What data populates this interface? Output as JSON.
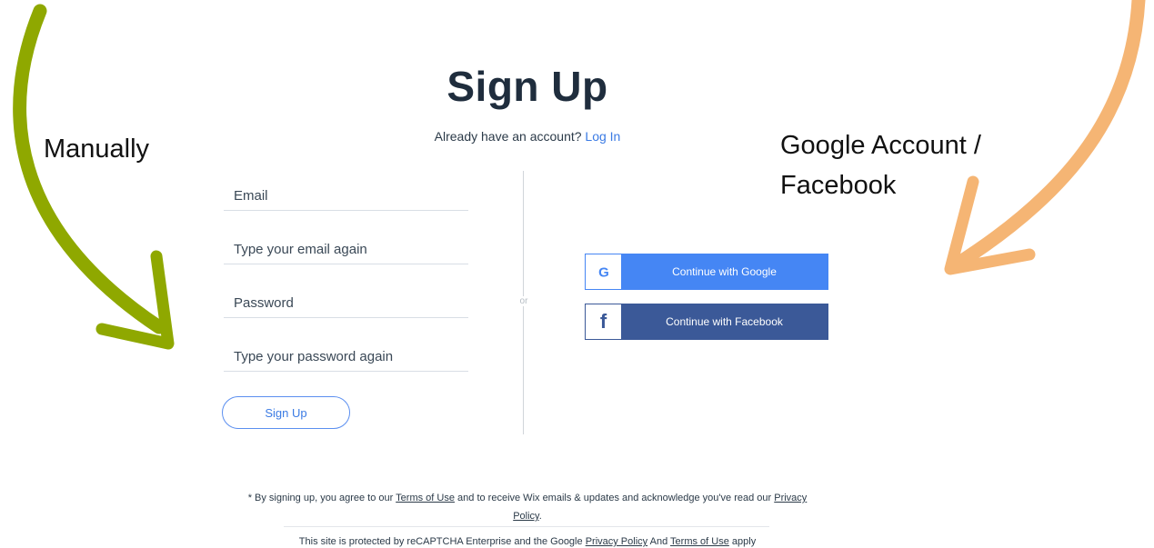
{
  "header": {
    "title": "Sign Up",
    "login_prompt": "Already have an account?",
    "login_link": "Log In"
  },
  "form": {
    "email_placeholder": "Email",
    "email_confirm_placeholder": "Type your email again",
    "password_placeholder": "Password",
    "password_confirm_placeholder": "Type your password again",
    "submit_label": "Sign Up"
  },
  "divider": {
    "or_label": "or"
  },
  "social": {
    "google_label": "Continue with Google",
    "google_icon_text": "G",
    "google_icon": "google-g-icon",
    "facebook_label": "Continue with Facebook",
    "facebook_icon_text": "f",
    "facebook_icon": "facebook-f-icon"
  },
  "annotations": {
    "manual": "Manually",
    "social_line1": "Google Account /",
    "social_line2": "Facebook"
  },
  "legal": {
    "prefix": "* By signing up, you agree to our",
    "terms": "Terms of Use",
    "middle": "and to receive Wix emails & updates and acknowledge you've read our",
    "privacy": "Privacy Policy",
    "suffix": ".",
    "recaptcha_prefix": "This site is protected by reCAPTCHA Enterprise and the Google",
    "recaptcha_privacy": "Privacy Policy",
    "recaptcha_and": "And",
    "recaptcha_terms": "Terms of Use",
    "recaptcha_suffix": "apply"
  },
  "colors": {
    "google_blue": "#4586f4",
    "facebook_blue": "#3b5998",
    "link_blue": "#3b7be4",
    "arrow_green": "#8fa800",
    "arrow_orange": "#f5b574"
  }
}
